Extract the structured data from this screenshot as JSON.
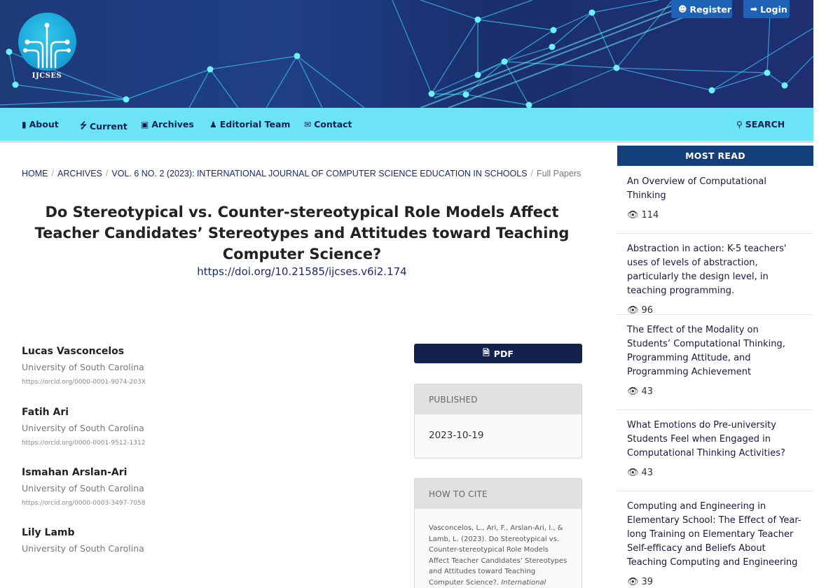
{
  "header": {
    "logo_text": "IJCSES",
    "register_label": "Register",
    "login_label": "Login",
    "colors": {
      "banner": "#1d3a78",
      "accent_cyan": "#6de3f6",
      "navy": "#13214f"
    }
  },
  "nav": {
    "items": [
      {
        "label": "About",
        "icon": "book-icon"
      },
      {
        "label": "Current",
        "icon": "bolt-icon"
      },
      {
        "label": "Archives",
        "icon": "archive-icon"
      },
      {
        "label": "Editorial Team",
        "icon": "users-icon"
      },
      {
        "label": "Contact",
        "icon": "envelope-icon"
      }
    ],
    "search_label": "SEARCH"
  },
  "breadcrumb": {
    "home": "HOME",
    "archives": "ARCHIVES",
    "issue": "VOL. 6 NO. 2 (2023): INTERNATIONAL JOURNAL OF COMPUTER SCIENCE EDUCATION IN SCHOOLS",
    "current": "Full Papers"
  },
  "article": {
    "title": "Do Stereotypical vs. Counter-stereotypical Role Models Affect Teacher Candidates’ Stereotypes and Attitudes toward Teaching Computer Science?",
    "doi": "https://doi.org/10.21585/ijcses.v6i2.174"
  },
  "authors": [
    {
      "name": "Lucas Vasconcelos",
      "affiliation": "University of South Carolina",
      "orcid": "https://orcid.org/0000-0001-9074-203X"
    },
    {
      "name": "Fatih Ari",
      "affiliation": "University of South Carolina",
      "orcid": "https://orcid.org/0000-0001-9512-1312"
    },
    {
      "name": "Ismahan Arslan-Ari",
      "affiliation": "University of South Carolina",
      "orcid": "https://orcid.org/0000-0003-3497-7058"
    },
    {
      "name": "Lily Lamb",
      "affiliation": "University of South Carolina",
      "orcid": ""
    }
  ],
  "pdf_label": "PDF",
  "published": {
    "heading": "PUBLISHED",
    "date": "2023-10-19"
  },
  "cite": {
    "heading": "HOW TO CITE",
    "text": "Vasconcelos, L., Ari, F., Arslan-Ari, I., & Lamb, L. (2023). Do Stereotypical vs. Counter-stereotypical Role Models Affect Teacher Candidates’ Stereotypes and Attitudes toward Teaching Computer Science?. ",
    "journal": "International Journal of"
  },
  "sidebar": {
    "heading": "MOST READ",
    "items": [
      {
        "title": "An Overview of Computational Thinking",
        "views": "114"
      },
      {
        "title": "Abstraction in action: K-5 teachers' uses of levels of abstraction, particularly the design level, in teaching programming.",
        "views": "96"
      },
      {
        "title": "The Effect of the Modality on Students’ Computational Thinking, Programming Attitude, and Programming Achievement",
        "views": "43"
      },
      {
        "title": "What Emotions do Pre-university Students Feel when Engaged in Computational Thinking Activities?",
        "views": "43"
      },
      {
        "title": "Computing and Engineering in Elementary School: The Effect of Year-long Training on Elementary Teacher Self-efficacy and Beliefs About Teaching Computing and Engineering",
        "views": "39"
      }
    ]
  }
}
